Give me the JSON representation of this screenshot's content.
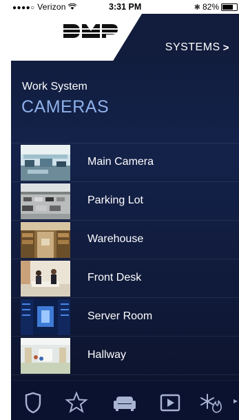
{
  "status_bar": {
    "signal_dots": "●●●●○",
    "carrier": "Verizon",
    "time": "3:31 PM",
    "battery_text": "82%",
    "battery_level": 0.82
  },
  "header": {
    "logo_text": "DMP",
    "systems_label": "SYSTEMS",
    "systems_chevron": ">"
  },
  "section": {
    "subtitle": "Work System",
    "title": "CAMERAS"
  },
  "cameras": [
    {
      "label": "Main Camera",
      "thumb": "office"
    },
    {
      "label": "Parking Lot",
      "thumb": "parking"
    },
    {
      "label": "Warehouse",
      "thumb": "warehouse"
    },
    {
      "label": "Front Desk",
      "thumb": "desk"
    },
    {
      "label": "Server Room",
      "thumb": "server"
    },
    {
      "label": "Hallway",
      "thumb": "hallway"
    }
  ],
  "tabbar": {
    "icons": [
      "shield-icon",
      "star-icon",
      "sofa-icon",
      "play-icon",
      "snowflake-flame-icon"
    ],
    "more": "▸",
    "accent": "#a8b4d2"
  },
  "colors": {
    "background": "#121c3c",
    "title_accent": "#8fb0ea"
  }
}
